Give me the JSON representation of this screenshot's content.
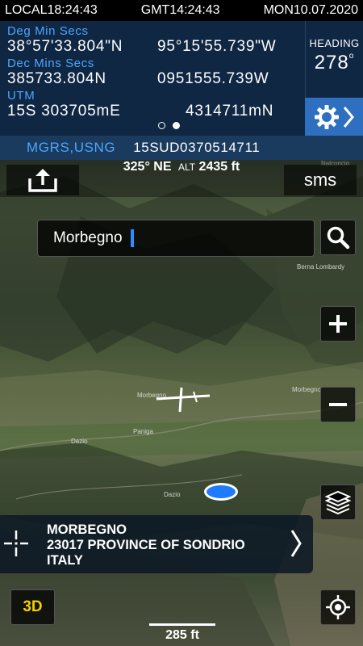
{
  "status": {
    "local": "LOCAL18:24:43",
    "gmt": "GMT14:24:43",
    "date": "MON10.07.2020"
  },
  "coords": {
    "dms_label": "Deg Min Secs",
    "dms_lat": "38°57'33.804\"N",
    "dms_lon": "95°15'55.739\"W",
    "dm_label": "Dec Mins Secs",
    "dm_lat": "385733.804N",
    "dm_lon": "0951555.739W",
    "utm_label": "UTM",
    "utm_zone": "15S 303705mE",
    "utm_north": "4314711mN"
  },
  "heading": {
    "label": "HEADING",
    "value": "278"
  },
  "mgrs": {
    "label": "MGRS,USNG",
    "value": "15SUD0370514711"
  },
  "map": {
    "orientation": "325° NE",
    "alt_label": "ALT",
    "alt_value": "2435 ft",
    "sms_label": "sms",
    "search_value": "Morbegno",
    "place": {
      "line1": "MORBEGNO",
      "line2": "23017 PROVINCE OF SONDRIO",
      "line3": "ITALY"
    },
    "mode_3d": "3D",
    "scale": "285 ft",
    "towns": [
      "Morbegno",
      "Morbegno",
      "Berna Lombardy",
      "Dazio",
      "Dazio",
      "Paniga",
      "Nalconcio"
    ]
  },
  "colors": {
    "panel_bg": "#0f2743",
    "label_blue": "#4da6ff",
    "settings_bg": "#2f6fbf",
    "mgrs_bg": "#1a3a5e",
    "location_dot": "#1e7bff",
    "btn_3d_text": "#f5d000"
  }
}
